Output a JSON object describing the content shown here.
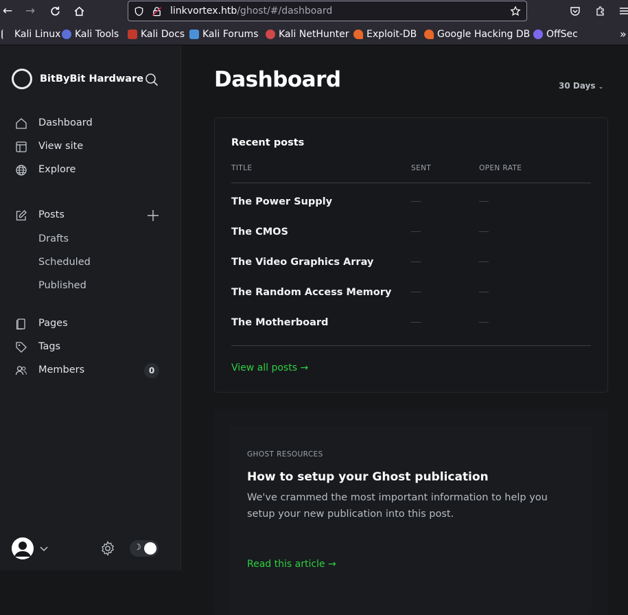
{
  "browser": {
    "url_host": "linkvortex.htb",
    "url_path": "/ghost/#/dashboard",
    "bookmarks": [
      {
        "label": "Kali Linux",
        "color": "#6b8fd6"
      },
      {
        "label": "Kali Tools",
        "color": "#d34f4f"
      },
      {
        "label": "Kali Docs",
        "color": "#c0392b"
      },
      {
        "label": "Kali Forums",
        "color": "#4a90d9"
      },
      {
        "label": "Kali NetHunter",
        "color": "#d04848"
      },
      {
        "label": "Exploit-DB",
        "color": "#e8672a"
      },
      {
        "label": "Google Hacking DB",
        "color": "#e8672a"
      },
      {
        "label": "OffSec",
        "color": "#7b68ee"
      }
    ]
  },
  "sidebar": {
    "brand": "BitByBit Hardware",
    "nav": [
      {
        "label": "Dashboard",
        "icon": "home-icon"
      },
      {
        "label": "View site",
        "icon": "layout-icon"
      },
      {
        "label": "Explore",
        "icon": "globe-icon"
      }
    ],
    "posts": {
      "label": "Posts",
      "subitems": [
        "Drafts",
        "Scheduled",
        "Published"
      ]
    },
    "secondary": [
      {
        "label": "Pages",
        "icon": "pages-icon"
      },
      {
        "label": "Tags",
        "icon": "tag-icon"
      },
      {
        "label": "Members",
        "icon": "members-icon",
        "count": "0"
      }
    ]
  },
  "main": {
    "title": "Dashboard",
    "range": "30 Days",
    "recent_posts": {
      "title": "Recent posts",
      "columns": [
        "TITLE",
        "SENT",
        "OPEN RATE"
      ],
      "rows": [
        "The Power Supply",
        "The CMOS",
        "The Video Graphics Array",
        "The Random Access Memory",
        "The Motherboard"
      ],
      "view_all": "View all posts →"
    },
    "resources": {
      "label": "GHOST RESOURCES",
      "title": "How to setup your Ghost publication",
      "description": "We've crammed the most important information to help you setup your new publication into this post.",
      "link": "Read this article →"
    }
  },
  "colors": {
    "accent_green": "#30cf43",
    "sidebar_bg": "#1b1d21",
    "main_bg": "#151719"
  }
}
